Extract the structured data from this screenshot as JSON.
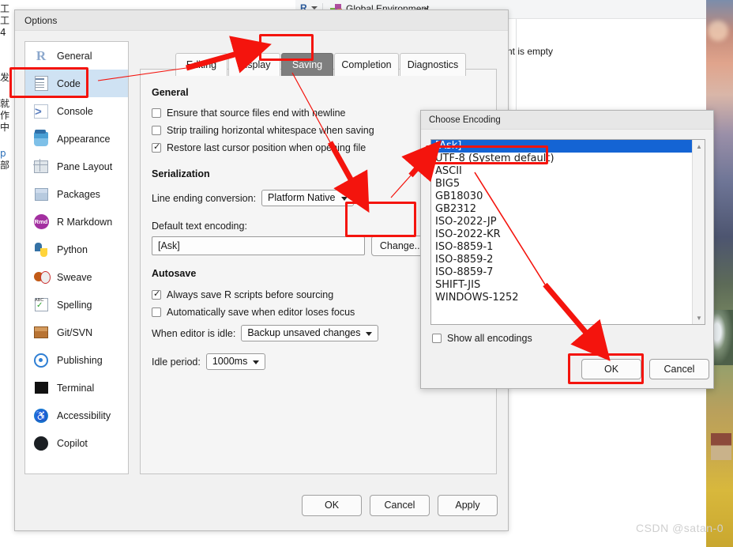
{
  "background": {
    "toolbar": {
      "r_label": "R",
      "environment_label": "Global Environment",
      "search_placeholder": ""
    },
    "environment_message": "nt is empty",
    "left_edge_fragments": [
      "工",
      "工",
      "4",
      "发",
      "就",
      "作",
      "中",
      "p",
      "部"
    ],
    "watermark": "CSDN @satan-0"
  },
  "options_dialog": {
    "title": "Options",
    "sidebar": [
      {
        "label": "General",
        "icon": "r-logo-icon",
        "selected": false
      },
      {
        "label": "Code",
        "icon": "code-document-icon",
        "selected": true
      },
      {
        "label": "Console",
        "icon": "console-prompt-icon",
        "selected": false
      },
      {
        "label": "Appearance",
        "icon": "paint-bucket-icon",
        "selected": false
      },
      {
        "label": "Pane Layout",
        "icon": "pane-grid-icon",
        "selected": false
      },
      {
        "label": "Packages",
        "icon": "package-box-icon",
        "selected": false
      },
      {
        "label": "R Markdown",
        "icon": "rmd-badge-icon",
        "selected": false
      },
      {
        "label": "Python",
        "icon": "python-icon",
        "selected": false
      },
      {
        "label": "Sweave",
        "icon": "sweave-pdf-icon",
        "selected": false
      },
      {
        "label": "Spelling",
        "icon": "spellcheck-icon",
        "selected": false
      },
      {
        "label": "Git/SVN",
        "icon": "git-box-icon",
        "selected": false
      },
      {
        "label": "Publishing",
        "icon": "publish-icon",
        "selected": false
      },
      {
        "label": "Terminal",
        "icon": "terminal-icon",
        "selected": false
      },
      {
        "label": "Accessibility",
        "icon": "accessibility-icon",
        "selected": false
      },
      {
        "label": "Copilot",
        "icon": "github-copilot-icon",
        "selected": false
      }
    ],
    "tabs": [
      {
        "label": "Editing",
        "active": false
      },
      {
        "label": "Display",
        "active": false
      },
      {
        "label": "Saving",
        "active": true
      },
      {
        "label": "Completion",
        "active": false
      },
      {
        "label": "Diagnostics",
        "active": false
      }
    ],
    "sections": {
      "general": {
        "title": "General",
        "checkboxes": [
          {
            "label": "Ensure that source files end with newline",
            "checked": false
          },
          {
            "label": "Strip trailing horizontal whitespace when saving",
            "checked": false
          },
          {
            "label": "Restore last cursor position when opening file",
            "checked": true
          }
        ]
      },
      "serialization": {
        "title": "Serialization",
        "line_ending_label": "Line ending conversion:",
        "line_ending_value": "Platform Native",
        "default_encoding_label": "Default text encoding:",
        "default_encoding_value": "[Ask]",
        "change_button": "Change..."
      },
      "autosave": {
        "title": "Autosave",
        "checkboxes": [
          {
            "label": "Always save R scripts before sourcing",
            "checked": true
          },
          {
            "label": "Automatically save when editor loses focus",
            "checked": false
          }
        ],
        "idle_action_label": "When editor is idle:",
        "idle_action_value": "Backup unsaved changes",
        "idle_period_label": "Idle period:",
        "idle_period_value": "1000ms"
      }
    },
    "buttons": {
      "ok": "OK",
      "cancel": "Cancel",
      "apply": "Apply"
    }
  },
  "encoding_dialog": {
    "title": "Choose Encoding",
    "items": [
      {
        "label": "[Ask]",
        "selected": true
      },
      {
        "label": "UTF-8 (System default)",
        "selected": false
      },
      {
        "label": "ASCII",
        "selected": false
      },
      {
        "label": "BIG5",
        "selected": false
      },
      {
        "label": "GB18030",
        "selected": false
      },
      {
        "label": "GB2312",
        "selected": false
      },
      {
        "label": "ISO-2022-JP",
        "selected": false
      },
      {
        "label": "ISO-2022-KR",
        "selected": false
      },
      {
        "label": "ISO-8859-1",
        "selected": false
      },
      {
        "label": "ISO-8859-2",
        "selected": false
      },
      {
        "label": "ISO-8859-7",
        "selected": false
      },
      {
        "label": "SHIFT-JIS",
        "selected": false
      },
      {
        "label": "WINDOWS-1252",
        "selected": false
      }
    ],
    "show_all_label": "Show all encodings",
    "show_all_checked": false,
    "ok": "OK",
    "cancel": "Cancel"
  },
  "annotations": {
    "highlight_color": "#f4140d",
    "boxes": [
      "sidebar-code-item",
      "saving-tab",
      "change-button",
      "utf8-encoding-item",
      "encoding-ok-button"
    ]
  }
}
